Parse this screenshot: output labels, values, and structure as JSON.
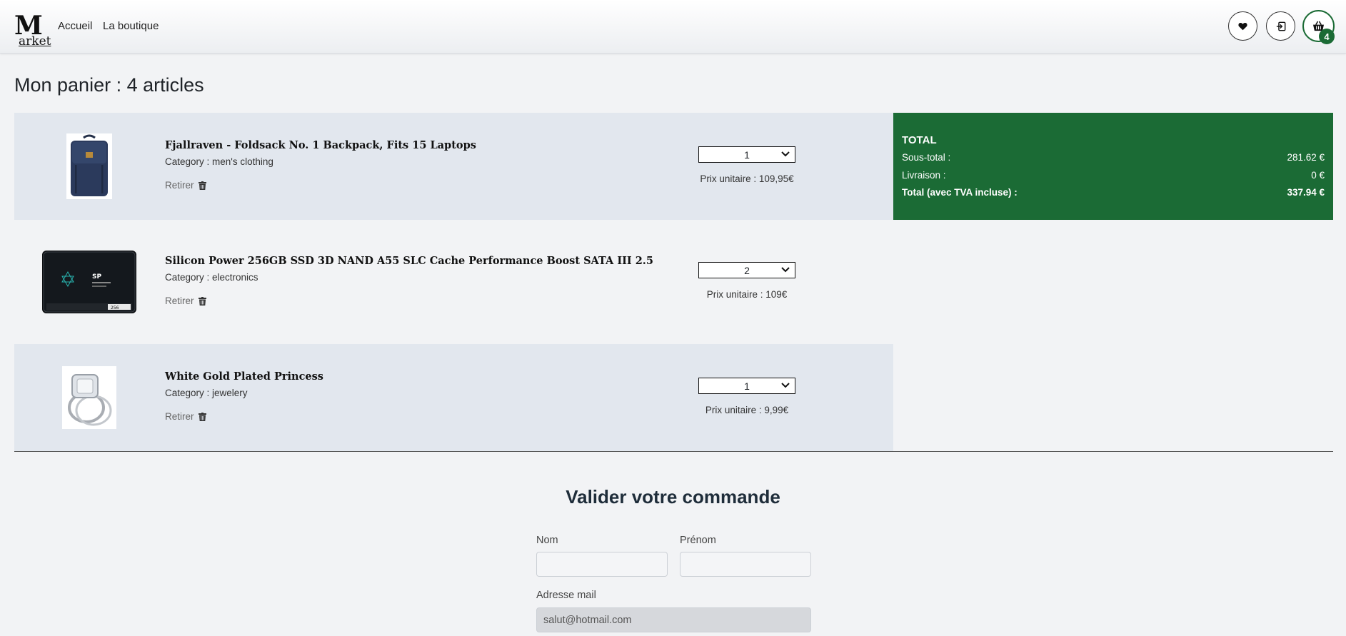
{
  "header": {
    "logo_main": "M",
    "logo_rest": "arket",
    "nav": [
      "Accueil",
      "La boutique"
    ],
    "icons": [
      "heart-icon",
      "sign-in-icon",
      "basket-icon"
    ],
    "cart_count": "4"
  },
  "page_title": "Mon panier : 4 articles",
  "cart_items": [
    {
      "name": "Fjallraven - Foldsack No. 1 Backpack, Fits 15 Laptops",
      "category": "Category : men's clothing",
      "remove_label": "Retirer",
      "quantity": "1",
      "unit_price": "Prix unitaire : 109,95€"
    },
    {
      "name": "Silicon Power 256GB SSD 3D NAND A55 SLC Cache Performance Boost SATA III 2.5",
      "category": "Category : electronics",
      "remove_label": "Retirer",
      "quantity": "2",
      "unit_price": "Prix unitaire : 109€"
    },
    {
      "name": "White Gold Plated Princess",
      "category": "Category : jewelery",
      "remove_label": "Retirer",
      "quantity": "1",
      "unit_price": "Prix unitaire : 9,99€"
    }
  ],
  "total": {
    "title": "TOTAL",
    "subtotal_label": "Sous-total :",
    "subtotal_value": "281.62 €",
    "shipping_label": "Livraison :",
    "shipping_value": "0 €",
    "grand_label": "Total (avec TVA incluse) :",
    "grand_value": "337.94 €"
  },
  "checkout": {
    "title": "Valider votre commande",
    "nom_label": "Nom",
    "nom_value": "",
    "prenom_label": "Prénom",
    "prenom_value": "",
    "email_label": "Adresse mail",
    "email_value": "salut@hotmail.com"
  },
  "colors": {
    "accent_green": "#1b6b35",
    "row_shade": "#e2e7ee",
    "background": "#f2f3f5"
  }
}
